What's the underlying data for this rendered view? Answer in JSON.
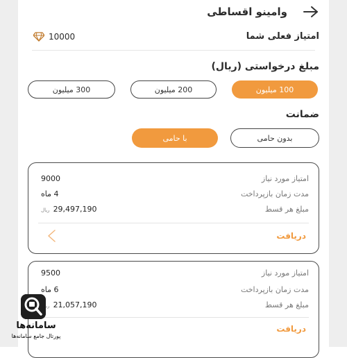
{
  "header": {
    "title": "وامینو اقساطی"
  },
  "points": {
    "label": "امتیاز فعلی شما",
    "value": "10000"
  },
  "amount": {
    "title": "مبلغ درخواستی (ریال)",
    "options": [
      "100 میلیون",
      "200 میلیون",
      "300 میلیون"
    ],
    "selected_index": 0
  },
  "guarantee": {
    "title": "ضمانت",
    "options": [
      "با حامی",
      "بدون حامی"
    ],
    "selected_index": 0
  },
  "offers": [
    {
      "rows": [
        {
          "label": "امتیاز مورد نیاز",
          "value": "9000"
        },
        {
          "label": "مدت زمان بازپرداخت",
          "value": "4 ماه"
        },
        {
          "label": "مبلغ هر قسط",
          "value": "29,497,190",
          "unit": "ریال"
        }
      ],
      "cta": "دریافت"
    },
    {
      "rows": [
        {
          "label": "امتیاز مورد نیاز",
          "value": "9500"
        },
        {
          "label": "مدت زمان بازپرداخت",
          "value": "6 ماه"
        },
        {
          "label": "مبلغ هر قسط",
          "value": "21,057,190",
          "unit": "ریال"
        }
      ],
      "cta": "دریافت"
    }
  ],
  "watermark": {
    "name": "سامانه‌ها",
    "tagline": "پورتال جامع سامانه‌ها"
  },
  "colors": {
    "accent": "#f19a3e",
    "border": "#4a4a4a"
  }
}
